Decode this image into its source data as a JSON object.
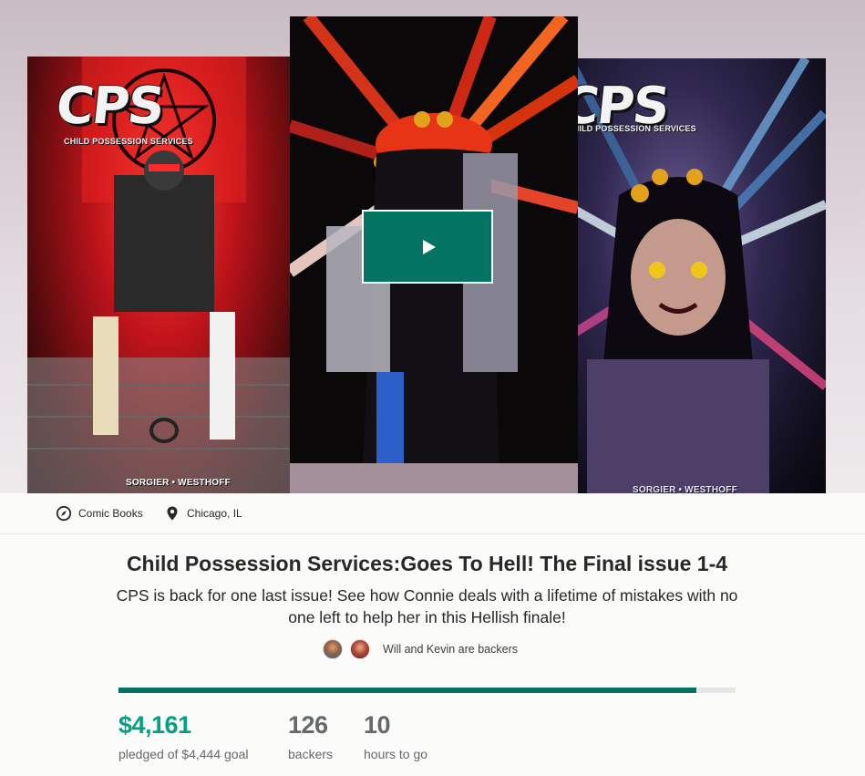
{
  "hero": {
    "covers": [
      {
        "logo": "CPS",
        "subtitle": "CHILD POSSESSION SERVICES",
        "credits": "SORGIER • WESTHOFF"
      },
      {
        "logo": "",
        "subtitle": "",
        "credits": ""
      },
      {
        "logo": "CPS",
        "subtitle": "CHILD POSSESSION SERVICES",
        "credits": "SORGIER • WESTHOFF"
      }
    ],
    "play_icon": "play-icon"
  },
  "meta": {
    "category": "Comic Books",
    "category_icon": "compass-icon",
    "location": "Chicago, IL",
    "location_icon": "map-pin-icon"
  },
  "project": {
    "title": "Child Possession Services:Goes To Hell! The Final issue 1-4",
    "blurb": "CPS is back for one last issue! See how Connie deals with a lifetime of mistakes with no one left to help her in this Hellish finale!",
    "backers_text": "Will and Kevin are backers"
  },
  "funding": {
    "pledged": "$4,161",
    "pledged_label": "pledged of $4,444 goal",
    "progress_fraction": 0.936,
    "backers": "126",
    "backers_label": "backers",
    "time_left": "10",
    "time_label": "hours to go"
  },
  "colors": {
    "accent_green": "#037362",
    "pledged_green": "#05a081"
  }
}
